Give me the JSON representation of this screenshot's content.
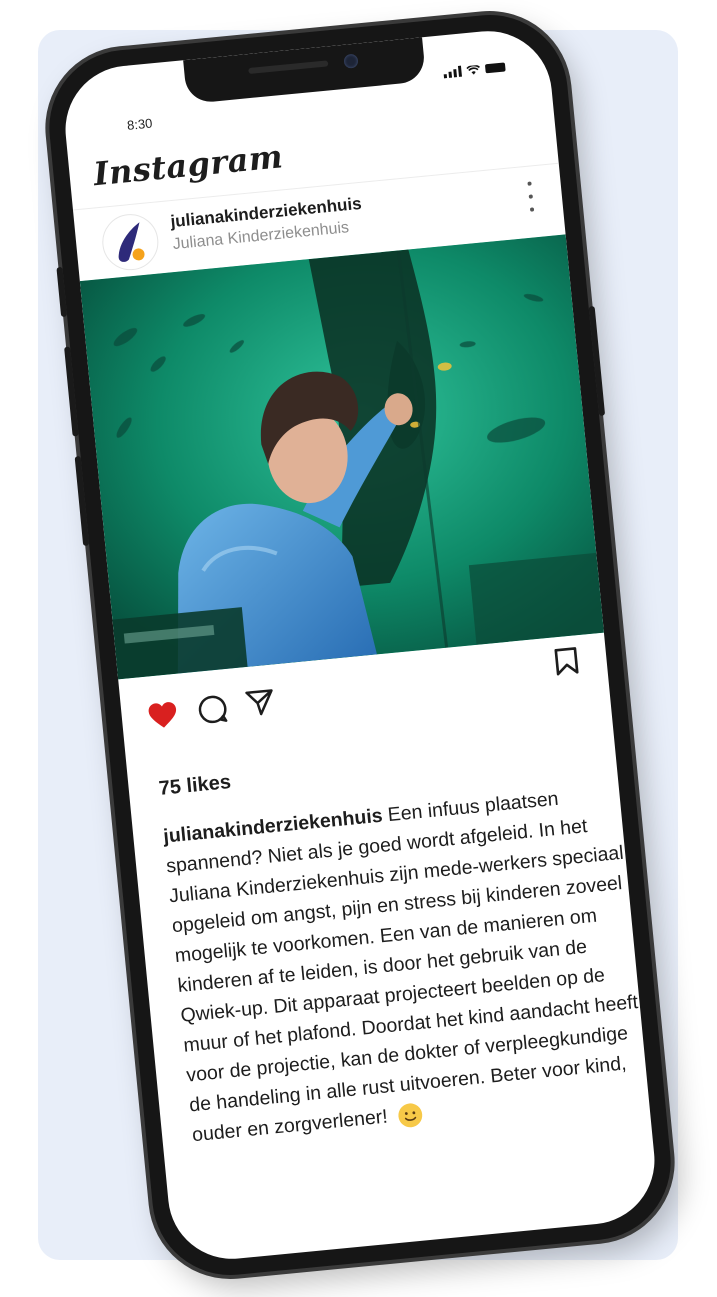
{
  "status_bar": {
    "time": "8:30"
  },
  "app": {
    "logo_text": "Instagram"
  },
  "post": {
    "username": "julianakinderziekenhuis",
    "full_name": "Juliana Kinderziekenhuis",
    "liked": true,
    "likes_text": "75 likes",
    "caption_username": "julianakinderziekenhuis",
    "caption_text": "Een infuus plaatsen spannend? Niet als je goed wordt afgeleid. In het Juliana Kinderziekenhuis zijn mede-werkers speciaal opgeleid om angst, pijn en stress bij kinderen zoveel mogelijk te voorkomen. Een van de manieren om kinderen af te leiden, is door het gebruik van de Qwiek-up. Dit apparaat projecteert beelden op de muur of het plafond. Doordat het kind aandacht heeft voor de projectie, kan de dokter of verpleegkundige de handeling in alle rust uitvoeren. Beter voor kind, ouder en zorgverlener!"
  },
  "colors": {
    "background_panel": "#e8eef9",
    "phone_frame": "#161616",
    "like_red": "#d9201f",
    "avatar_blue": "#2e2a7a",
    "avatar_orange": "#f5a21b",
    "image_green": "#0f8f6a"
  },
  "icons": {
    "like": "heart-icon",
    "comment": "comment-icon",
    "share": "send-icon",
    "save": "bookmark-icon",
    "more": "more-vertical-icon",
    "emoji": "smiley-icon"
  }
}
